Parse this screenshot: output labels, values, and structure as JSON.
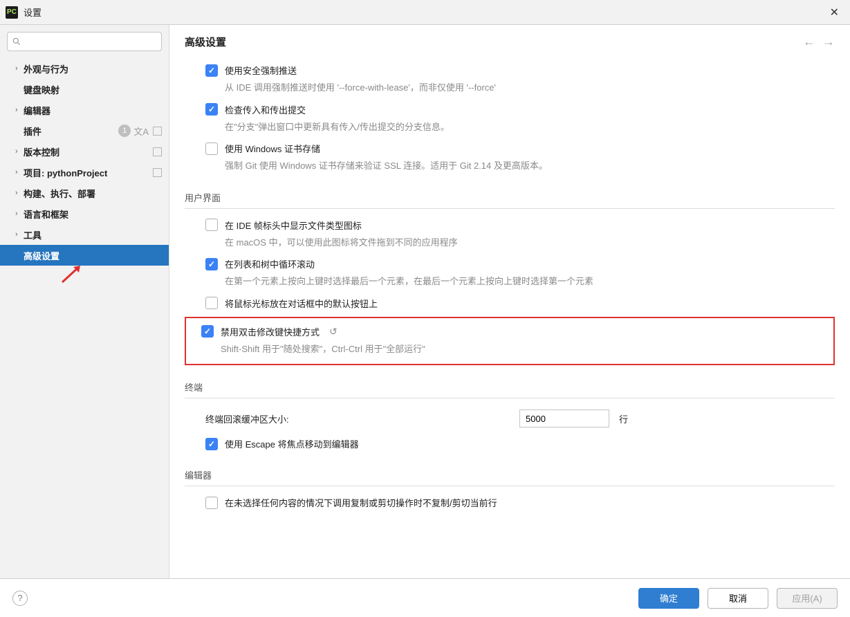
{
  "window": {
    "title": "设置",
    "app_icon_text": "PC"
  },
  "search": {
    "placeholder": ""
  },
  "sidebar": {
    "items": [
      {
        "label": "外观与行为",
        "has_children": true
      },
      {
        "label": "键盘映射",
        "has_children": false
      },
      {
        "label": "编辑器",
        "has_children": true
      },
      {
        "label": "插件",
        "has_children": false,
        "badge": "1",
        "extras": true
      },
      {
        "label": "版本控制",
        "has_children": true,
        "project": true
      },
      {
        "label": "项目: pythonProject",
        "has_children": true,
        "project": true
      },
      {
        "label": "构建、执行、部署",
        "has_children": true
      },
      {
        "label": "语言和框架",
        "has_children": true
      },
      {
        "label": "工具",
        "has_children": true
      },
      {
        "label": "高级设置",
        "has_children": false,
        "selected": true
      }
    ]
  },
  "content": {
    "title": "高级设置",
    "groups": [
      {
        "items": [
          {
            "checked": true,
            "label": "使用安全强制推送",
            "desc": "从 IDE 调用强制推送时使用 '--force-with-lease'，而非仅使用 '--force'"
          },
          {
            "checked": true,
            "label": "检查传入和传出提交",
            "desc": "在\"分支\"弹出窗口中更新具有传入/传出提交的分支信息。"
          },
          {
            "checked": false,
            "label": "使用 Windows 证书存储",
            "desc": "强制 Git 使用 Windows 证书存储来验证 SSL 连接。适用于 Git 2.14 及更高版本。"
          }
        ]
      },
      {
        "title": "用户界面",
        "items": [
          {
            "checked": false,
            "label": "在 IDE 帧标头中显示文件类型图标",
            "desc": "在 macOS 中，可以使用此图标将文件拖到不同的应用程序"
          },
          {
            "checked": true,
            "label": "在列表和树中循环滚动",
            "desc": "在第一个元素上按向上键时选择最后一个元素，在最后一个元素上按向上键时选择第一个元素"
          },
          {
            "checked": false,
            "label": "将鼠标光标放在对话框中的默认按钮上"
          },
          {
            "checked": true,
            "label": "禁用双击修改键快捷方式",
            "desc": "Shift-Shift 用于\"随处搜索\"，Ctrl-Ctrl 用于\"全部运行\"",
            "highlight": true,
            "reset": true
          }
        ]
      },
      {
        "title": "终端",
        "numrow": {
          "label": "终端回滚缓冲区大小:",
          "value": "5000",
          "suffix": "行"
        },
        "items": [
          {
            "checked": true,
            "label": "使用 Escape 将焦点移动到编辑器"
          }
        ]
      },
      {
        "title": "编辑器",
        "items": [
          {
            "checked": false,
            "label": "在未选择任何内容的情况下调用复制或剪切操作时不复制/剪切当前行"
          }
        ]
      }
    ]
  },
  "footer": {
    "ok": "确定",
    "cancel": "取消",
    "apply": "应用(A)"
  }
}
